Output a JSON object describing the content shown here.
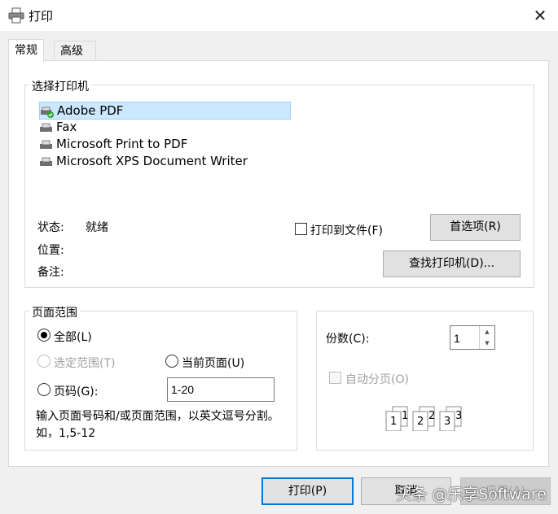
{
  "window": {
    "title": "打印",
    "close_label": "✕"
  },
  "tabs": [
    {
      "label": "常规",
      "active": true
    },
    {
      "label": "高级",
      "active": false
    }
  ],
  "select_printer": {
    "label": "选择打印机",
    "printers": [
      {
        "name": "Adobe PDF",
        "selected": true,
        "icon": "printer-default-icon"
      },
      {
        "name": "Fax",
        "selected": false,
        "icon": "fax-printer-icon"
      },
      {
        "name": "Microsoft Print to PDF",
        "selected": false,
        "icon": "printer-icon"
      },
      {
        "name": "Microsoft XPS Document Writer",
        "selected": false,
        "icon": "printer-icon"
      }
    ],
    "status_label": "状态:",
    "status_value": "就绪",
    "location_label": "位置:",
    "comment_label": "备注:",
    "print_to_file_label": "打印到文件(F)",
    "print_to_file_checked": false,
    "preferences_button": "首选项(R)",
    "find_printer_button": "查找打印机(D)..."
  },
  "page_range": {
    "label": "页面范围",
    "all_label": "全部(L)",
    "selection_label": "选定范围(T)",
    "current_page_label": "当前页面(U)",
    "pages_label": "页码(G):",
    "pages_value": "1-20",
    "selected_option": "all",
    "hint": "输入页面号码和/或页面范围，以英文逗号分割。如，1,5-12"
  },
  "copies": {
    "label": "份数(C):",
    "value": "1",
    "collate_label": "自动分页(O)",
    "collate_enabled": false,
    "collate_pages": [
      "1",
      "1",
      "2",
      "2",
      "3",
      "3"
    ]
  },
  "buttons": {
    "print": "打印(P)",
    "cancel": "取消",
    "apply": "应用(A)"
  },
  "watermark": "头条 @乐享Software"
}
